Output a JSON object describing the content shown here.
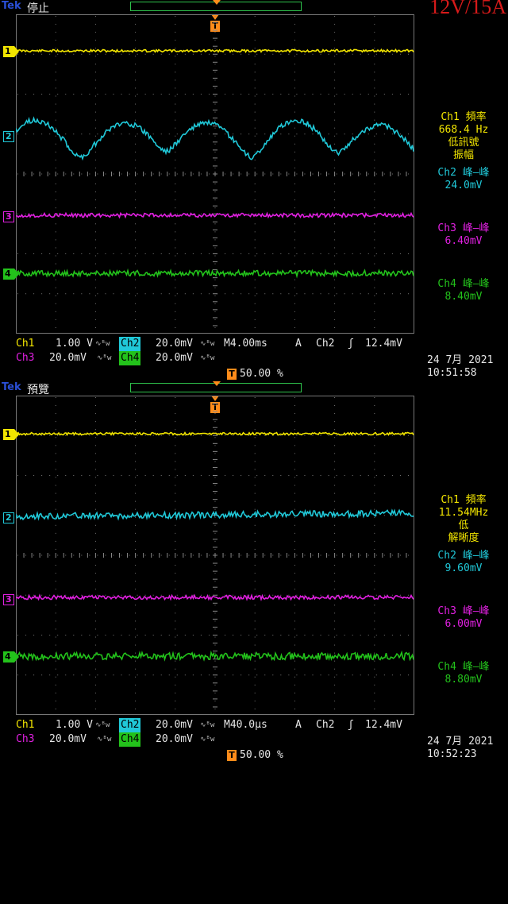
{
  "title": "12V/15A",
  "brand": "Tek",
  "colors": {
    "ch1": "#f2e500",
    "ch2": "#20c8d8",
    "ch3": "#e020e0",
    "ch4": "#23c21b",
    "trigger": "#ff8c1a",
    "grid": "#666666"
  },
  "panels": [
    {
      "state": "停止",
      "markers": [
        "1",
        "2",
        "3",
        "4"
      ],
      "measurements": {
        "ch1_label": "Ch1 頻率",
        "ch1_value": "668.4 Hz",
        "ch1_note1": "低訊號",
        "ch1_note2": "振幅",
        "ch2_label": "Ch2 峰–峰",
        "ch2_value": "24.0mV",
        "ch3_label": "Ch3 峰–峰",
        "ch3_value": "6.40mV",
        "ch4_label": "Ch4 峰–峰",
        "ch4_value": "8.40mV"
      },
      "status": {
        "ch1": "Ch1",
        "ch1_scale": "1.00 V",
        "ch2": "Ch2",
        "ch2_scale": "20.0mV",
        "ch3": "Ch3",
        "ch3_scale": "20.0mV",
        "ch4": "Ch4",
        "ch4_scale": "20.0mV",
        "bw_icon": "bandwidth-limit-icon",
        "timebase": "M4.00ms",
        "trig_mode": "A",
        "trig_src": "Ch2",
        "trig_slope_icon": "rising-edge-icon",
        "trig_level": "12.4mV",
        "position": "50.00 %"
      },
      "date": "24 7月  2021",
      "time": "10:51:58"
    },
    {
      "state": "預覽",
      "markers": [
        "1",
        "2",
        "3",
        "4"
      ],
      "measurements": {
        "ch1_label": "Ch1 頻率",
        "ch1_value": "11.54MHz",
        "ch1_note1": "低",
        "ch1_note2": "解晰度",
        "ch2_label": "Ch2 峰–峰",
        "ch2_value": "9.60mV",
        "ch3_label": "Ch3 峰–峰",
        "ch3_value": "6.00mV",
        "ch4_label": "Ch4 峰–峰",
        "ch4_value": "8.80mV"
      },
      "status": {
        "ch1": "Ch1",
        "ch1_scale": "1.00 V",
        "ch2": "Ch2",
        "ch2_scale": "20.0mV",
        "ch3": "Ch3",
        "ch3_scale": "20.0mV",
        "ch4": "Ch4",
        "ch4_scale": "20.0mV",
        "bw_icon": "bandwidth-limit-icon",
        "timebase": "M40.0µs",
        "trig_mode": "A",
        "trig_src": "Ch2",
        "trig_slope_icon": "rising-edge-icon",
        "trig_level": "12.4mV",
        "position": "50.00 %"
      },
      "date": "24 7月  2021",
      "time": "10:52:23"
    }
  ]
}
